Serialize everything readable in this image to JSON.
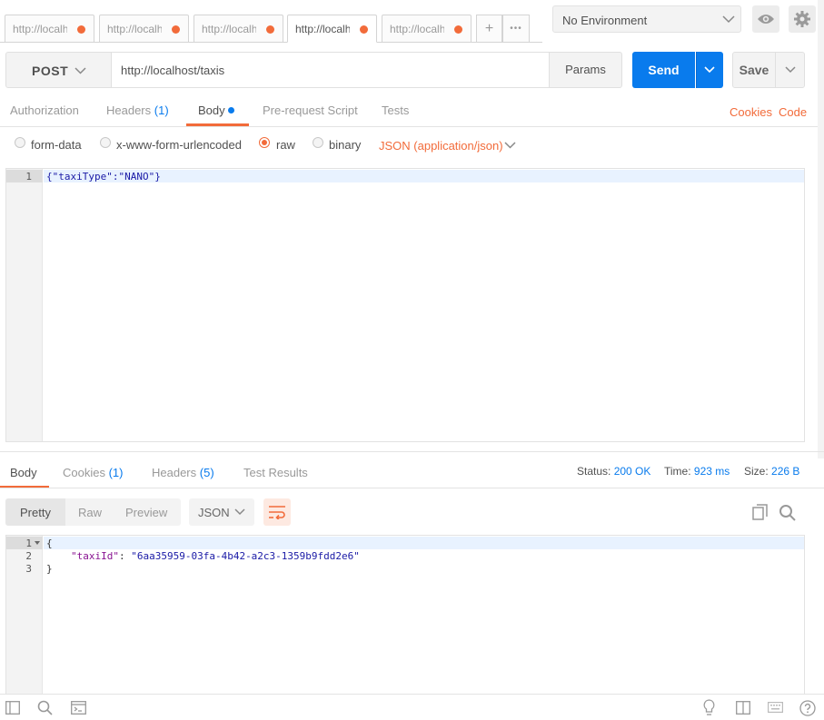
{
  "tabs": [
    {
      "label": "http://localhost/taxis",
      "active": false,
      "unsaved": true
    },
    {
      "label": "http://localhost/taxis",
      "active": false,
      "unsaved": true
    },
    {
      "label": "http://localhost/taxis",
      "active": false,
      "unsaved": true
    },
    {
      "label": "http://localhost/taxis",
      "active": true,
      "unsaved": true
    },
    {
      "label": "http://localhost/taxis",
      "active": false,
      "unsaved": true
    }
  ],
  "tab_controls": {
    "add": "+",
    "more": "•••"
  },
  "environment": {
    "selected": "No Environment"
  },
  "request": {
    "method": "POST",
    "url": "http://localhost/taxis",
    "params_label": "Params",
    "send_label": "Send",
    "save_label": "Save"
  },
  "request_tabs": {
    "authorization": "Authorization",
    "headers": "Headers",
    "headers_count": "(1)",
    "body": "Body",
    "prerequest": "Pre-request Script",
    "tests": "Tests",
    "cookies_link": "Cookies",
    "code_link": "Code"
  },
  "body_modes": {
    "form_data": "form-data",
    "urlencoded": "x-www-form-urlencoded",
    "raw": "raw",
    "binary": "binary",
    "selected": "raw",
    "content_type": "JSON (application/json)"
  },
  "request_body": {
    "lines": [
      "1"
    ],
    "code": "{\"taxiType\":\"NANO\"}"
  },
  "response_tabs": {
    "body": "Body",
    "cookies": "Cookies",
    "cookies_count": "(1)",
    "headers": "Headers",
    "headers_count": "(5)",
    "test_results": "Test Results"
  },
  "response_meta": {
    "status_label": "Status:",
    "status_value": "200 OK",
    "time_label": "Time:",
    "time_value": "923 ms",
    "size_label": "Size:",
    "size_value": "226 B"
  },
  "response_view": {
    "pretty": "Pretty",
    "raw": "Raw",
    "preview": "Preview",
    "format": "JSON"
  },
  "response_body": {
    "line1_num": "1",
    "line2_num": "2",
    "line3_num": "3",
    "line1": "{",
    "line2_key": "\"taxiId\"",
    "line2_sep": ": ",
    "line2_val": "\"6aa35959-03fa-4b42-a2c3-1359b9fdd2e6\"",
    "line3": "}"
  },
  "colors": {
    "accent": "#f26b3a",
    "send_blue": "#097bed",
    "status_blue": "#097bed"
  }
}
